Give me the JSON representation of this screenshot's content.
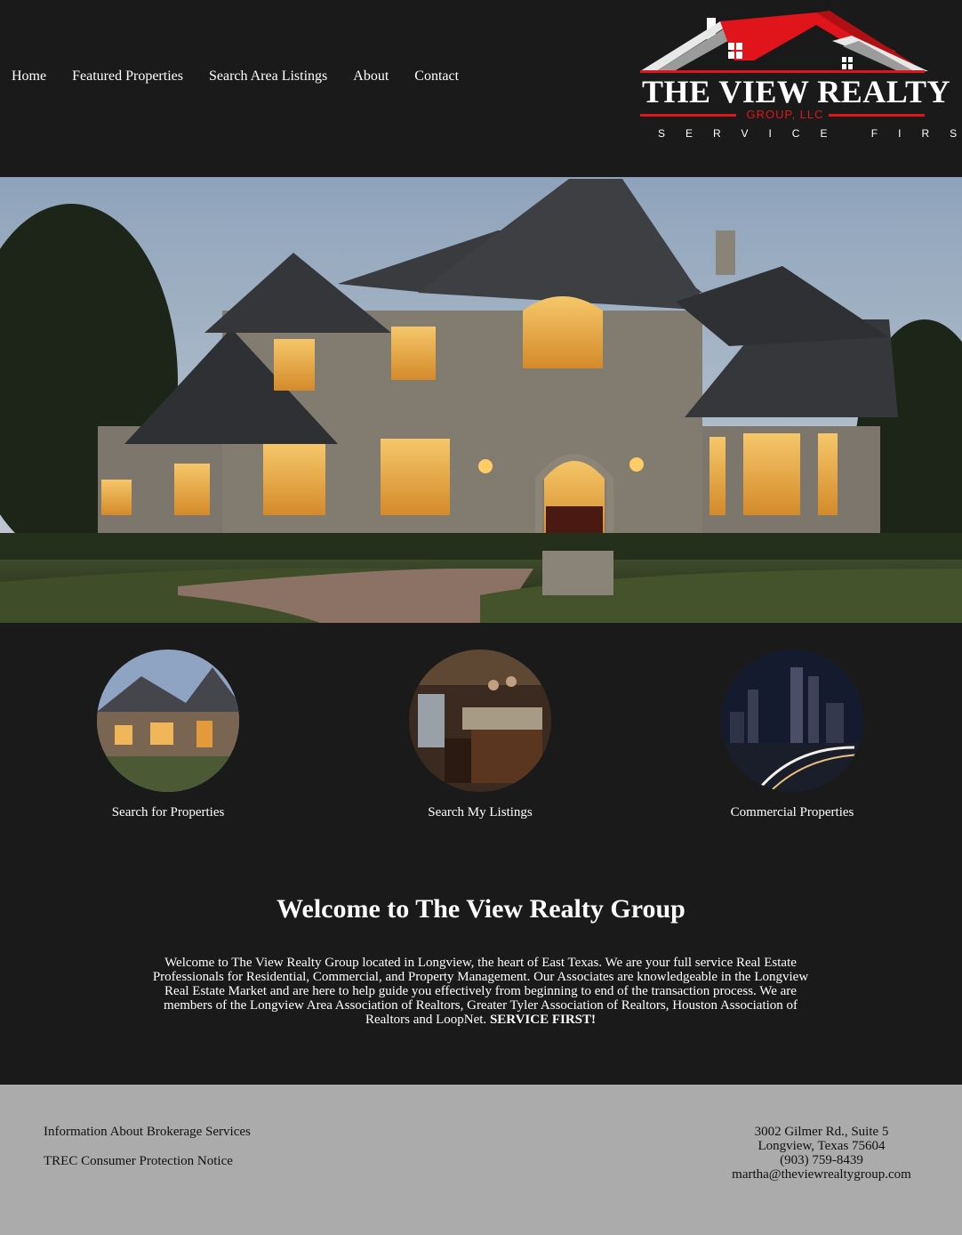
{
  "nav": {
    "items": [
      {
        "label": "Home"
      },
      {
        "label": "Featured Properties"
      },
      {
        "label": "Search Area Listings"
      },
      {
        "label": "About"
      },
      {
        "label": "Contact"
      }
    ]
  },
  "logo": {
    "title": "THE VIEW REALTY",
    "subtitle": "GROUP, LLC",
    "tagline": "SERVICE FIRST",
    "accent": "#e0151b"
  },
  "features": [
    {
      "label": "Search for Properties",
      "icon": "house-photo"
    },
    {
      "label": "Search My Listings",
      "icon": "kitchen-photo"
    },
    {
      "label": "Commercial Properties",
      "icon": "city-night-photo"
    }
  ],
  "welcome": {
    "title": "Welcome to The View Realty Group",
    "body": "Welcome to The View Realty Group located in Longview, the heart of East Texas. We are your full service Real Estate Professionals for Residential, Commercial, and Property Management. Our Associates are knowledgeable in the Longview Real Estate Market and are here to help guide you effectively from beginning to end of the transaction process. We are members of the Longview Area Association of Realtors, Greater Tyler Association of Realtors, Houston Association of Realtors and LoopNet.",
    "emphasis": "SERVICE FIRST!"
  },
  "footer": {
    "links": [
      {
        "label": "Information About Brokerage Services"
      },
      {
        "label": "TREC Consumer Protection Notice"
      }
    ],
    "address1": "3002 Gilmer Rd., Suite 5",
    "address2": "Longview, Texas 75604",
    "phone": "(903) 759-8439",
    "email": "martha@theviewrealtygroup.com"
  },
  "colors": {
    "background": "#1a1a1b",
    "footer": "#ababab",
    "brand_red": "#e0151b"
  }
}
